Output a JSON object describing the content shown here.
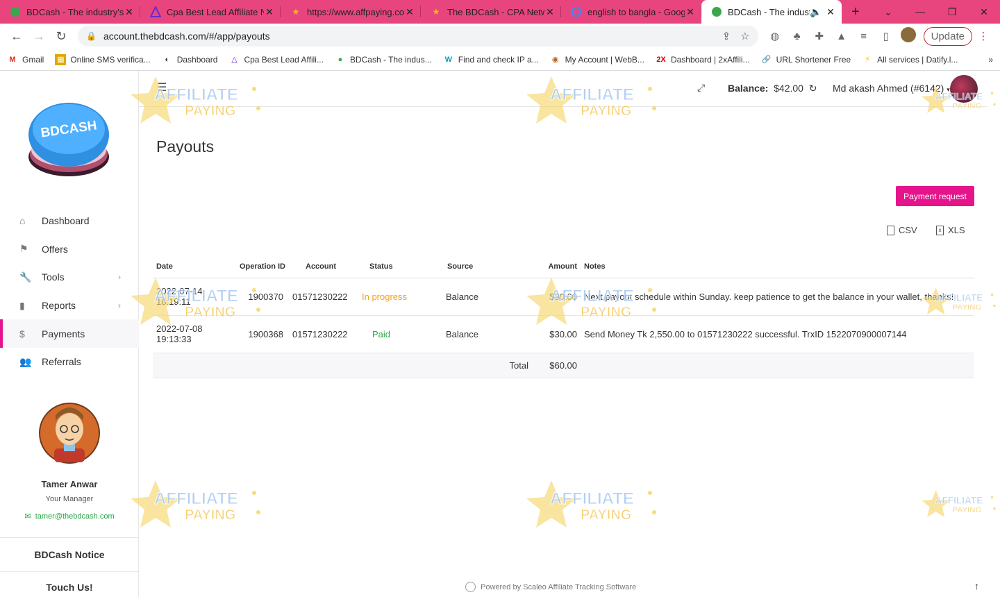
{
  "browser": {
    "tabs": [
      {
        "title": "BDCash - The industry's le",
        "icon": "bdcash-favicon"
      },
      {
        "title": "Cpa Best Lead Affiliate Ne",
        "icon": "cpa-favicon"
      },
      {
        "title": "https://www.affpaying.com",
        "icon": "affpaying-favicon"
      },
      {
        "title": "The BDCash - CPA Netwo",
        "icon": "affpaying-favicon"
      },
      {
        "title": "english to bangla - Googl",
        "icon": "google-favicon"
      },
      {
        "title": "BDCash - The industry",
        "icon": "bdcash-favicon"
      }
    ],
    "url": "account.thebdcash.com/#/app/payouts",
    "update_label": "Update",
    "bookmarks": [
      "Gmail",
      "Online SMS verifica...",
      "Dashboard",
      "Cpa Best Lead Affili...",
      "BDCash - The indus...",
      "Find and check IP a...",
      "My Account | WebB...",
      "Dashboard | 2xAffili...",
      "URL Shortener Free",
      "All services | Datify.l..."
    ]
  },
  "header": {
    "balance_label": "Balance:",
    "balance_value": "$42.00",
    "user": "Md akash Ahmed (#6142)"
  },
  "sidebar": {
    "logo_text": "BDCASH",
    "items": [
      {
        "label": "Dashboard",
        "icon": "home-icon"
      },
      {
        "label": "Offers",
        "icon": "flag-icon"
      },
      {
        "label": "Tools",
        "icon": "wrench-icon"
      },
      {
        "label": "Reports",
        "icon": "bar-chart-icon"
      },
      {
        "label": "Payments",
        "icon": "dollar-icon"
      },
      {
        "label": "Referrals",
        "icon": "users-icon"
      }
    ],
    "manager": {
      "name": "Tamer Anwar",
      "role": "Your Manager",
      "email": "tamer@thebdcash.com"
    },
    "notice": "BDCash Notice",
    "touch": "Touch Us!"
  },
  "main": {
    "title": "Payouts",
    "payment_request": "Payment request",
    "csv": "CSV",
    "xls": "XLS",
    "table": {
      "columns": [
        "Date",
        "Operation ID",
        "Account",
        "Status",
        "Source",
        "Amount",
        "Notes"
      ],
      "rows": [
        {
          "date": "2022-07-14",
          "time": "18:19:11",
          "op_id": "1900370",
          "account": "01571230222",
          "status": "In progress",
          "source": "Balance",
          "amount": "$30.00",
          "notes": "Next payout schedule within Sunday. keep patience to get the balance in your wallet, thanks!"
        },
        {
          "date": "2022-07-08",
          "time": "19:13:33",
          "op_id": "1900368",
          "account": "01571230222",
          "status": "Paid",
          "source": "Balance",
          "amount": "$30.00",
          "notes": "Send Money Tk 2,550.00 to 01571230222 successful. TrxID 1522070900007144"
        }
      ],
      "total_label": "Total",
      "total_value": "$60.00"
    },
    "footer": "Powered by Scaleo Affiliate Tracking Software"
  },
  "watermark": {
    "line1": "AFFILIATE",
    "line2": "PAYING"
  },
  "colors": {
    "accent": "#e6148c",
    "tab_bar": "#e8457f",
    "in_progress": "#f0a21b",
    "paid": "#28a745"
  }
}
